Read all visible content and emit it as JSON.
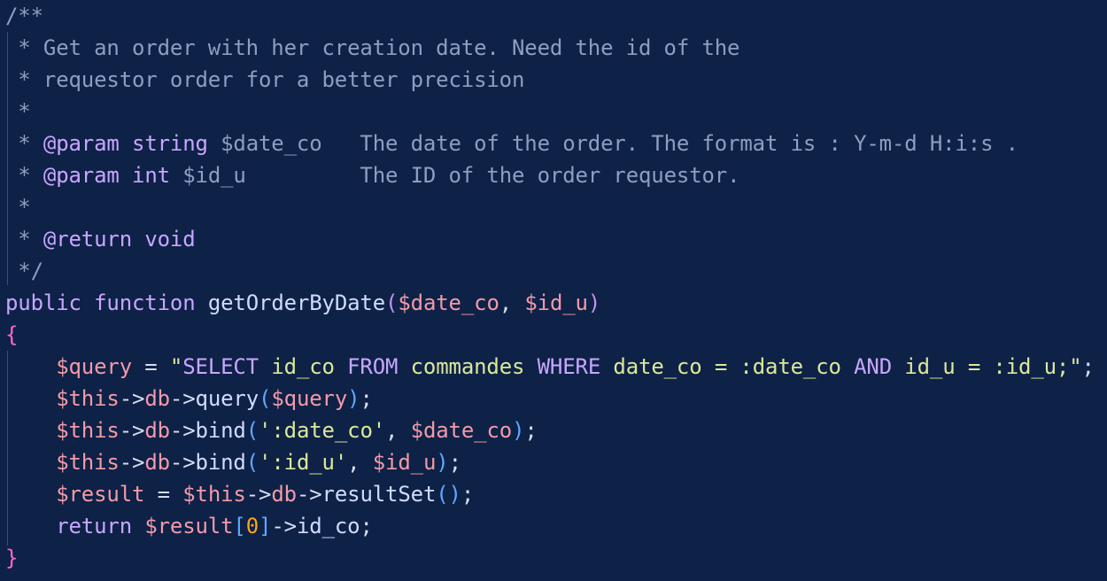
{
  "editor": {
    "lines": [
      [
        {
          "t": "/**",
          "c": "t-comment"
        }
      ],
      [
        {
          "t": " * Get an order with her creation date. Need the id of the",
          "c": "t-comment"
        }
      ],
      [
        {
          "t": " * requestor order for a better precision",
          "c": "t-comment"
        }
      ],
      [
        {
          "t": " *",
          "c": "t-comment"
        }
      ],
      [
        {
          "t": " * ",
          "c": "t-comment"
        },
        {
          "t": "@param",
          "c": "t-tag"
        },
        {
          "t": " ",
          "c": "t-comment"
        },
        {
          "t": "string",
          "c": "t-type"
        },
        {
          "t": " $date_co   The date of the order. The format is : Y-m-d H:i:s .",
          "c": "t-comment"
        }
      ],
      [
        {
          "t": " * ",
          "c": "t-comment"
        },
        {
          "t": "@param",
          "c": "t-tag"
        },
        {
          "t": " ",
          "c": "t-comment"
        },
        {
          "t": "int",
          "c": "t-type"
        },
        {
          "t": " $id_u         The ID of the order requestor.",
          "c": "t-comment"
        }
      ],
      [
        {
          "t": " *",
          "c": "t-comment"
        }
      ],
      [
        {
          "t": " * ",
          "c": "t-comment"
        },
        {
          "t": "@return",
          "c": "t-tag"
        },
        {
          "t": " ",
          "c": "t-comment"
        },
        {
          "t": "void",
          "c": "t-type"
        }
      ],
      [
        {
          "t": " */",
          "c": "t-comment"
        }
      ],
      [
        {
          "t": "public",
          "c": "t-key"
        },
        {
          "t": " ",
          "c": "t-plain"
        },
        {
          "t": "function",
          "c": "t-key"
        },
        {
          "t": " ",
          "c": "t-plain"
        },
        {
          "t": "getOrderByDate",
          "c": "t-func"
        },
        {
          "t": "(",
          "c": "t-paren"
        },
        {
          "t": "$date_co",
          "c": "t-var"
        },
        {
          "t": ", ",
          "c": "t-plain"
        },
        {
          "t": "$id_u",
          "c": "t-var"
        },
        {
          "t": ")",
          "c": "t-paren"
        }
      ],
      [
        {
          "t": "{",
          "c": "t-brace"
        }
      ],
      [
        {
          "t": "    ",
          "c": "t-plain"
        },
        {
          "t": "$query",
          "c": "t-var"
        },
        {
          "t": " = ",
          "c": "t-plain"
        },
        {
          "t": "\"",
          "c": "t-str"
        },
        {
          "t": "SELECT",
          "c": "t-key"
        },
        {
          "t": " id_co ",
          "c": "t-str"
        },
        {
          "t": "FROM",
          "c": "t-key"
        },
        {
          "t": " commandes ",
          "c": "t-str"
        },
        {
          "t": "WHERE",
          "c": "t-key"
        },
        {
          "t": " date_co = :date_co ",
          "c": "t-str"
        },
        {
          "t": "AND",
          "c": "t-key"
        },
        {
          "t": " id_u = :id_u;\"",
          "c": "t-str"
        },
        {
          "t": ";",
          "c": "t-plain"
        }
      ],
      [
        {
          "t": "    ",
          "c": "t-plain"
        },
        {
          "t": "$this",
          "c": "t-var"
        },
        {
          "t": "->",
          "c": "t-plain"
        },
        {
          "t": "db",
          "c": "t-var"
        },
        {
          "t": "->",
          "c": "t-plain"
        },
        {
          "t": "query",
          "c": "t-func"
        },
        {
          "t": "(",
          "c": "t-inner"
        },
        {
          "t": "$query",
          "c": "t-var"
        },
        {
          "t": ")",
          "c": "t-inner"
        },
        {
          "t": ";",
          "c": "t-plain"
        }
      ],
      [
        {
          "t": "    ",
          "c": "t-plain"
        },
        {
          "t": "$this",
          "c": "t-var"
        },
        {
          "t": "->",
          "c": "t-plain"
        },
        {
          "t": "db",
          "c": "t-var"
        },
        {
          "t": "->",
          "c": "t-plain"
        },
        {
          "t": "bind",
          "c": "t-func"
        },
        {
          "t": "(",
          "c": "t-inner"
        },
        {
          "t": "':date_co'",
          "c": "t-str"
        },
        {
          "t": ", ",
          "c": "t-plain"
        },
        {
          "t": "$date_co",
          "c": "t-var"
        },
        {
          "t": ")",
          "c": "t-inner"
        },
        {
          "t": ";",
          "c": "t-plain"
        }
      ],
      [
        {
          "t": "    ",
          "c": "t-plain"
        },
        {
          "t": "$this",
          "c": "t-var"
        },
        {
          "t": "->",
          "c": "t-plain"
        },
        {
          "t": "db",
          "c": "t-var"
        },
        {
          "t": "->",
          "c": "t-plain"
        },
        {
          "t": "bind",
          "c": "t-func"
        },
        {
          "t": "(",
          "c": "t-inner"
        },
        {
          "t": "':id_u'",
          "c": "t-str"
        },
        {
          "t": ", ",
          "c": "t-plain"
        },
        {
          "t": "$id_u",
          "c": "t-var"
        },
        {
          "t": ")",
          "c": "t-inner"
        },
        {
          "t": ";",
          "c": "t-plain"
        }
      ],
      [
        {
          "t": "    ",
          "c": "t-plain"
        },
        {
          "t": "$result",
          "c": "t-var"
        },
        {
          "t": " = ",
          "c": "t-plain"
        },
        {
          "t": "$this",
          "c": "t-var"
        },
        {
          "t": "->",
          "c": "t-plain"
        },
        {
          "t": "db",
          "c": "t-var"
        },
        {
          "t": "->",
          "c": "t-plain"
        },
        {
          "t": "resultSet",
          "c": "t-func"
        },
        {
          "t": "()",
          "c": "t-inner"
        },
        {
          "t": ";",
          "c": "t-plain"
        }
      ],
      [
        {
          "t": "    ",
          "c": "t-plain"
        },
        {
          "t": "return",
          "c": "t-key"
        },
        {
          "t": " ",
          "c": "t-plain"
        },
        {
          "t": "$result",
          "c": "t-var"
        },
        {
          "t": "[",
          "c": "t-inner"
        },
        {
          "t": "0",
          "c": "t-num"
        },
        {
          "t": "]",
          "c": "t-inner"
        },
        {
          "t": "->",
          "c": "t-plain"
        },
        {
          "t": "id_co",
          "c": "t-func"
        },
        {
          "t": ";",
          "c": "t-plain"
        }
      ],
      [
        {
          "t": "}",
          "c": "t-brace"
        }
      ]
    ]
  },
  "colors": {
    "background": "#0e2147",
    "comment": "#8d9ec2",
    "keyword": "#c8a6ff",
    "variable": "#f29aa8",
    "string": "#dbe89a",
    "brace": "#ff66cc",
    "bracket": "#5fa8ff",
    "number": "#f5a623"
  }
}
